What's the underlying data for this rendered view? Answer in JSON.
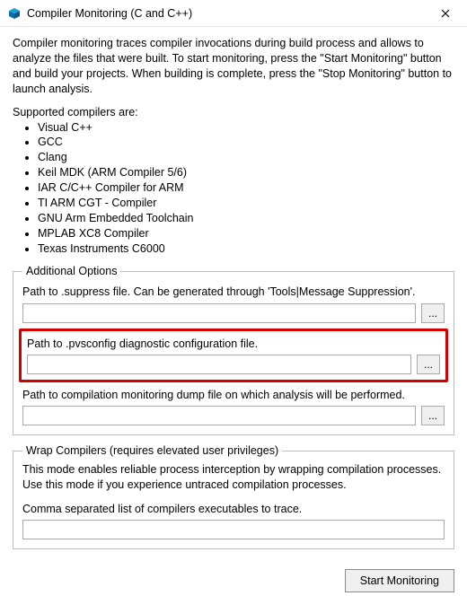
{
  "titlebar": {
    "title": "Compiler Monitoring (C and C++)"
  },
  "intro": "Compiler monitoring traces compiler invocations during build process and allows to analyze the files that were built. To start monitoring, press the \"Start Monitoring\" button and build your projects. When building is complete, press the \"Stop Monitoring\" button to launch analysis.",
  "supported_label": "Supported compilers are:",
  "compilers": [
    "Visual C++",
    "GCC",
    "Clang",
    "Keil MDK (ARM Compiler 5/6)",
    "IAR C/C++ Compiler for ARM",
    "TI ARM CGT - Compiler",
    "GNU Arm Embedded Toolchain",
    "MPLAB XC8 Compiler",
    "Texas Instruments C6000"
  ],
  "additional": {
    "legend": "Additional Options",
    "suppress_label": "Path to .suppress file. Can be generated through 'Tools|Message Suppression'.",
    "suppress_value": "",
    "pvsconfig_label": "Path to .pvsconfig diagnostic configuration file.",
    "pvsconfig_value": "",
    "dump_label": "Path to compilation monitoring dump file on which analysis will be performed.",
    "dump_value": "",
    "browse_label": "..."
  },
  "wrap": {
    "legend": "Wrap Compilers (requires elevated user privileges)",
    "description": "This mode enables reliable process interception by wrapping compilation processes. Use this mode if you experience untraced compilation processes.",
    "list_label": "Comma separated list of compilers executables to trace.",
    "list_value": ""
  },
  "footer": {
    "start_label": "Start Monitoring"
  }
}
